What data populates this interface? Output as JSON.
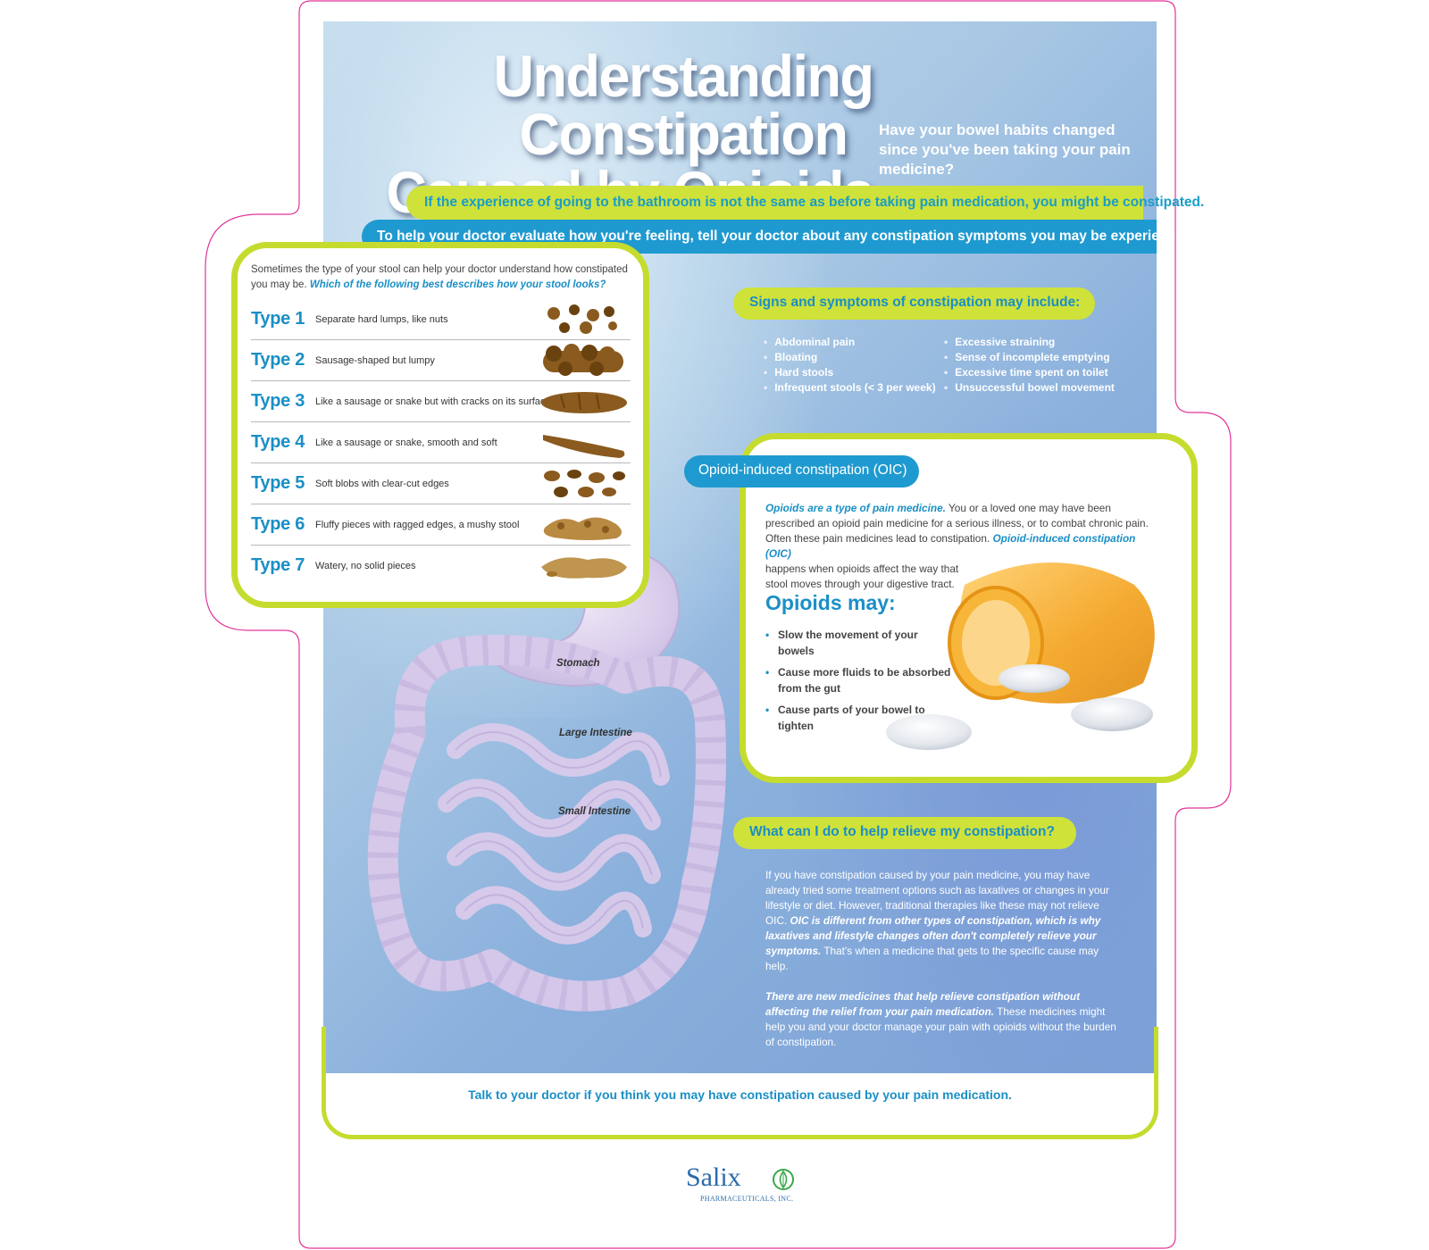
{
  "poster": {
    "title_line1": "Understanding Constipation",
    "title_line2": "Caused by Opioids",
    "subtitle": "Have your bowel habits changed since you've been taking your pain medicine?",
    "banner_green": "If the experience of going to the bathroom is not the same as before taking pain medication, you might be constipated.",
    "banner_blue": "To help your doctor evaluate how you're feeling, tell your doctor about any constipation symptoms you may be experiencing."
  },
  "stool_chart": {
    "intro": "Sometimes the type of your stool can help your doctor understand how constipated you may be.",
    "question": "Which of the following best describes how your stool looks?",
    "types": [
      {
        "label": "Type 1",
        "desc": "Separate hard lumps, like nuts",
        "icon": "stool-type1-icon"
      },
      {
        "label": "Type 2",
        "desc": "Sausage-shaped but lumpy",
        "icon": "stool-type2-icon"
      },
      {
        "label": "Type 3",
        "desc": "Like a sausage or snake but with cracks on its surface",
        "icon": "stool-type3-icon"
      },
      {
        "label": "Type 4",
        "desc": "Like a sausage or snake, smooth and soft",
        "icon": "stool-type4-icon"
      },
      {
        "label": "Type 5",
        "desc": "Soft blobs with clear-cut edges",
        "icon": "stool-type5-icon"
      },
      {
        "label": "Type 6",
        "desc": "Fluffy pieces with ragged edges, a mushy stool",
        "icon": "stool-type6-icon"
      },
      {
        "label": "Type 7",
        "desc": "Watery, no solid pieces",
        "icon": "stool-type7-icon"
      }
    ]
  },
  "signs": {
    "heading": "Signs and symptoms of constipation may include:",
    "col1": [
      "Abdominal pain",
      "Bloating",
      "Hard stools",
      "Infrequent stools (< 3 per week)"
    ],
    "col2": [
      "Excessive straining",
      "Sense of incomplete emptying",
      "Excessive time spent on toilet",
      "Unsuccessful bowel movement"
    ]
  },
  "oic": {
    "heading": "Opioid-induced constipation (OIC)",
    "em1": "Opioids are a type of pain medicine.",
    "text1": " You or a loved one may have been prescribed an opioid pain medicine for a serious illness, or to combat chronic pain. Often these pain medicines lead to constipation. ",
    "em2": "Opioid-induced constipation (OIC)",
    "text2": "happens when opioids affect the way that stool moves through your digestive tract.",
    "may_heading": "Opioids may:",
    "may_items": [
      "Slow the movement of your bowels",
      "Cause more fluids to be absorbed from the gut",
      "Cause parts of your bowel to tighten"
    ]
  },
  "organs": {
    "stomach": "Stomach",
    "large_intestine": "Large Intestine",
    "small_intestine": "Small Intestine"
  },
  "relief": {
    "heading": "What can I do to help relieve my constipation?",
    "p1_text": "If you have constipation caused by your pain medicine, you may have already tried some treatment options such as laxatives or changes in your lifestyle or diet. However, traditional therapies like these may not relieve OIC. ",
    "p1_em": "OIC is different from other types of constipation, which is why laxatives and lifestyle changes often don't completely relieve your symptoms.",
    "p1_tail": " That's when a medicine that gets to the specific cause may help.",
    "p2_em": "There are new medicines that help relieve constipation without affecting the relief from your pain medication.",
    "p2_text": " These medicines might help you and your doctor manage your pain with opioids without the burden of constipation."
  },
  "footer": {
    "text": "Talk to your doctor if you think you may have constipation caused by your pain medication."
  },
  "logo": {
    "name": "Salix",
    "sub": "PHARMACEUTICALS, INC."
  },
  "colors": {
    "accent_green": "#c5dc2e",
    "accent_blue": "#1a8fc6",
    "dieline": "#e0359a"
  }
}
